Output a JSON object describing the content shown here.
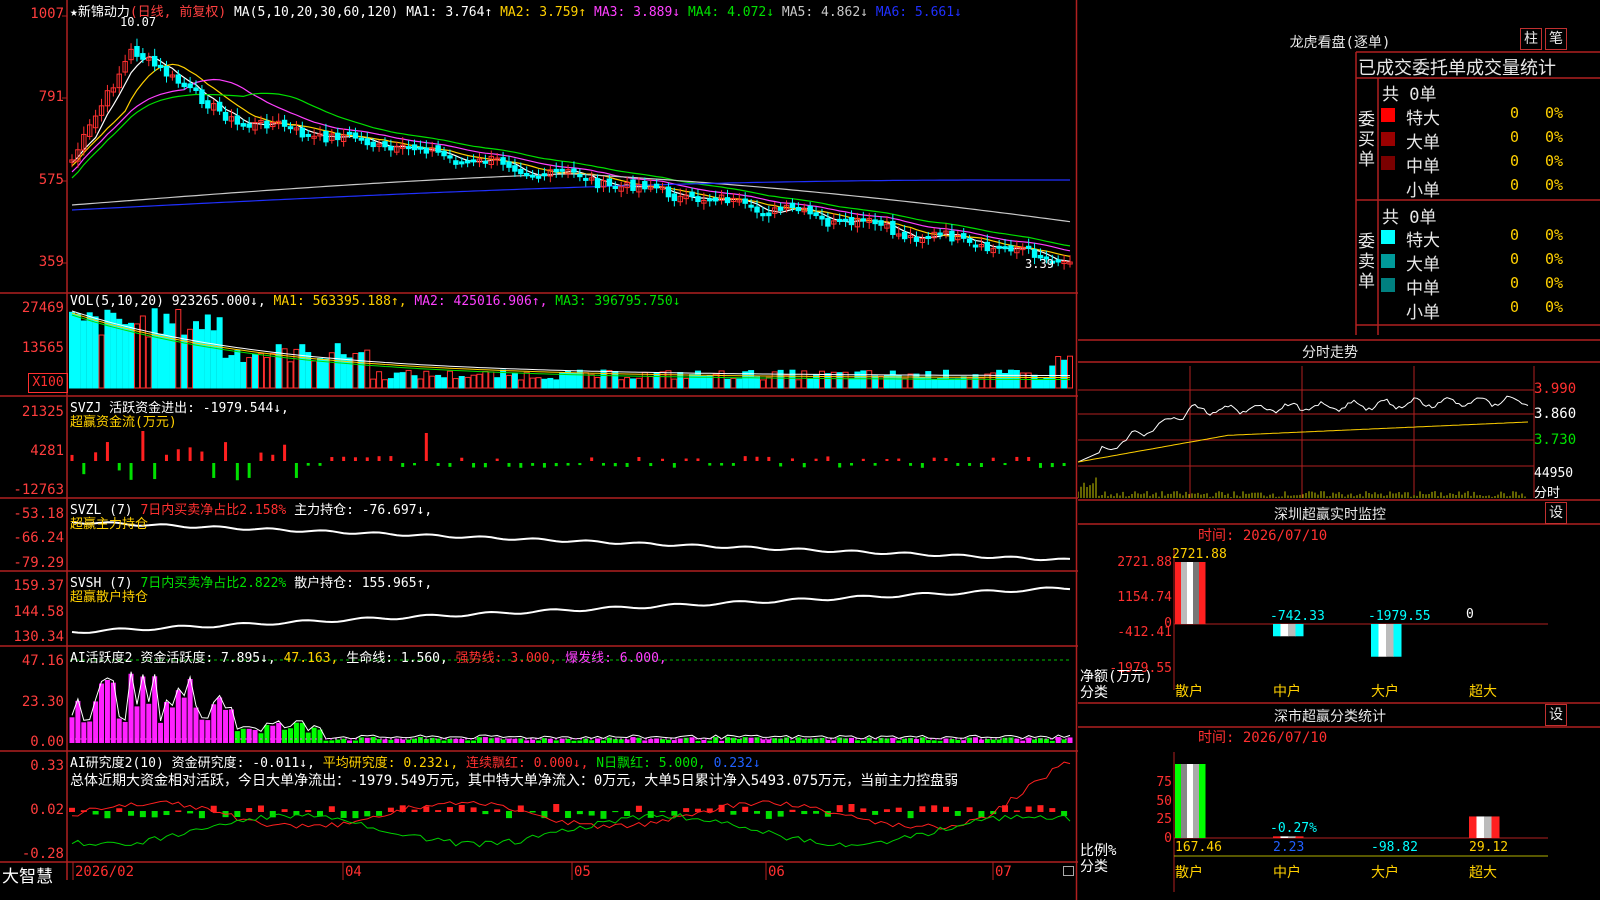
{
  "stock": {
    "name_star": "★",
    "name": "新锦动力",
    "period": "(日线, 前复权)",
    "ma_header": "MA(5,10,20,30,60,120)",
    "ma": [
      {
        "label": "MA1: 3.764↑",
        "color": "#ffffff"
      },
      {
        "label": "MA2: 3.759↑",
        "color": "#ffd000"
      },
      {
        "label": "MA3: 3.889↓",
        "color": "#ff40ff"
      },
      {
        "label": "MA4: 4.072↓",
        "color": "#00e000"
      },
      {
        "label": "MA5: 4.862↓",
        "color": "#c8c8c8"
      },
      {
        "label": "MA6: 5.661↓",
        "color": "#2030ff"
      }
    ],
    "high_marker": "10.07",
    "low_marker": "3.39"
  },
  "price_axis": [
    "1007",
    "791",
    "575",
    "359"
  ],
  "vol": {
    "header": "VOL(5,10,20)",
    "value": "923265.000↓,",
    "ma1": "MA1: 563395.188↑,",
    "ma2": "MA2: 425016.906↑,",
    "ma3": "MA3: 396795.750↓",
    "axis": [
      "27469",
      "13565"
    ],
    "unit_box": "X100"
  },
  "svzj": {
    "header": "SVZJ",
    "text": "活跃资金进出: -1979.544↓,",
    "sub": "超赢资金流(万元)",
    "axis": [
      "21325",
      "4281",
      "-12763"
    ]
  },
  "svzl": {
    "header": "SVZL (7)",
    "ratio": "7日内买卖净占比2.158%",
    "text": "主力持仓: -76.697↓,",
    "sub": "超赢主力持仓",
    "axis": [
      "-53.18",
      "-66.24",
      "-79.29"
    ]
  },
  "svsh": {
    "header": "SVSH (7)",
    "ratio": "7日内买卖净占比2.822%",
    "text": "散户持仓: 155.965↑,",
    "sub": "超赢散户持仓",
    "axis": [
      "159.37",
      "144.58",
      "130.34"
    ]
  },
  "ai_active": {
    "header": "AI活跃度2",
    "v1": "资金活跃度: 7.895↓,",
    "v2": "47.163,",
    "v3": "生命线: 1.560,",
    "v4": "强势线: 3.000,",
    "v5": "爆发线: 6.000,",
    "axis": [
      "47.16",
      "23.30",
      "0.00"
    ]
  },
  "ai_research": {
    "header": "AI研究度2(10)",
    "v1": "资金研究度: -0.011↓,",
    "v2": "平均研究度: 0.232↓,",
    "v3": "连续飘红: 0.000↓,",
    "v4": "N日飘红: 5.000,",
    "v5": "0.232↓",
    "summary": "总体近期大资金相对活跃，今日大单净流出：-1979.549万元，其中特大单净流入：0万元，大单5日累计净入5493.075万元，当前主力控盘弱",
    "axis": [
      "0.33",
      "0.02",
      "-0.28"
    ]
  },
  "bottom": {
    "brand": "大智慧",
    "dates": [
      "2026/02",
      "04",
      "05",
      "06",
      "07"
    ]
  },
  "dragon": {
    "title": "龙虎看盘(逐单)",
    "btn1": "柱",
    "btn2": "笔",
    "header": "已成交委托单成交量统计",
    "buy_side": "委买单",
    "sell_side": "委卖单",
    "buy_total": "共 0单",
    "sell_total": "共 0单",
    "buy_rows": [
      {
        "label": "特大",
        "count": "0",
        "pct": "0%",
        "color": "#ff0000"
      },
      {
        "label": "大单",
        "count": "0",
        "pct": "0%",
        "color": "#9a0000"
      },
      {
        "label": "中单",
        "count": "0",
        "pct": "0%",
        "color": "#7a0000"
      },
      {
        "label": "小单",
        "count": "0",
        "pct": "0%",
        "color": ""
      }
    ],
    "sell_rows": [
      {
        "label": "特大",
        "count": "0",
        "pct": "0%",
        "color": "#00ffff"
      },
      {
        "label": "大单",
        "count": "0",
        "pct": "0%",
        "color": "#009a9a"
      },
      {
        "label": "中单",
        "count": "0",
        "pct": "0%",
        "color": "#008080"
      },
      {
        "label": "小单",
        "count": "0",
        "pct": "0%",
        "color": ""
      }
    ]
  },
  "intraday": {
    "title": "分时走势",
    "axis": [
      "3.990",
      "3.860",
      "3.730"
    ],
    "vol_label": "44950",
    "vol_unit": "分时"
  },
  "sz_monitor": {
    "title": "深圳超赢实时监控",
    "btn": "设",
    "time": "时间: 2026/07/10",
    "axis": [
      "2721.88",
      "1154.74",
      "0",
      "-412.41",
      "-1979.55"
    ],
    "y_label": "净额(万元)",
    "x_label": "分类",
    "categories": [
      "散户",
      "中户",
      "大户",
      "超大"
    ],
    "values": [
      "2721.88",
      "-742.33",
      "-1979.55",
      "0"
    ],
    "value_colors": [
      "#ffd000",
      "#00ffff",
      "#00ffff",
      "#ffffff"
    ]
  },
  "sz_class": {
    "title": "深市超赢分类统计",
    "btn": "设",
    "time": "时间: 2026/07/10",
    "axis": [
      "75",
      "50",
      "25",
      "0"
    ],
    "y_label": "比例%",
    "x_label": "分类",
    "categories": [
      "散户",
      "中户",
      "大户",
      "超大"
    ],
    "top_values": [
      "",
      "-0.27%",
      "",
      ""
    ],
    "bottom_values": [
      "167.46",
      "2.23",
      "-98.82",
      "29.12"
    ],
    "bottom_colors": [
      "#ffd000",
      "#2060ff",
      "#00ffff",
      "#ffd000"
    ]
  }
}
